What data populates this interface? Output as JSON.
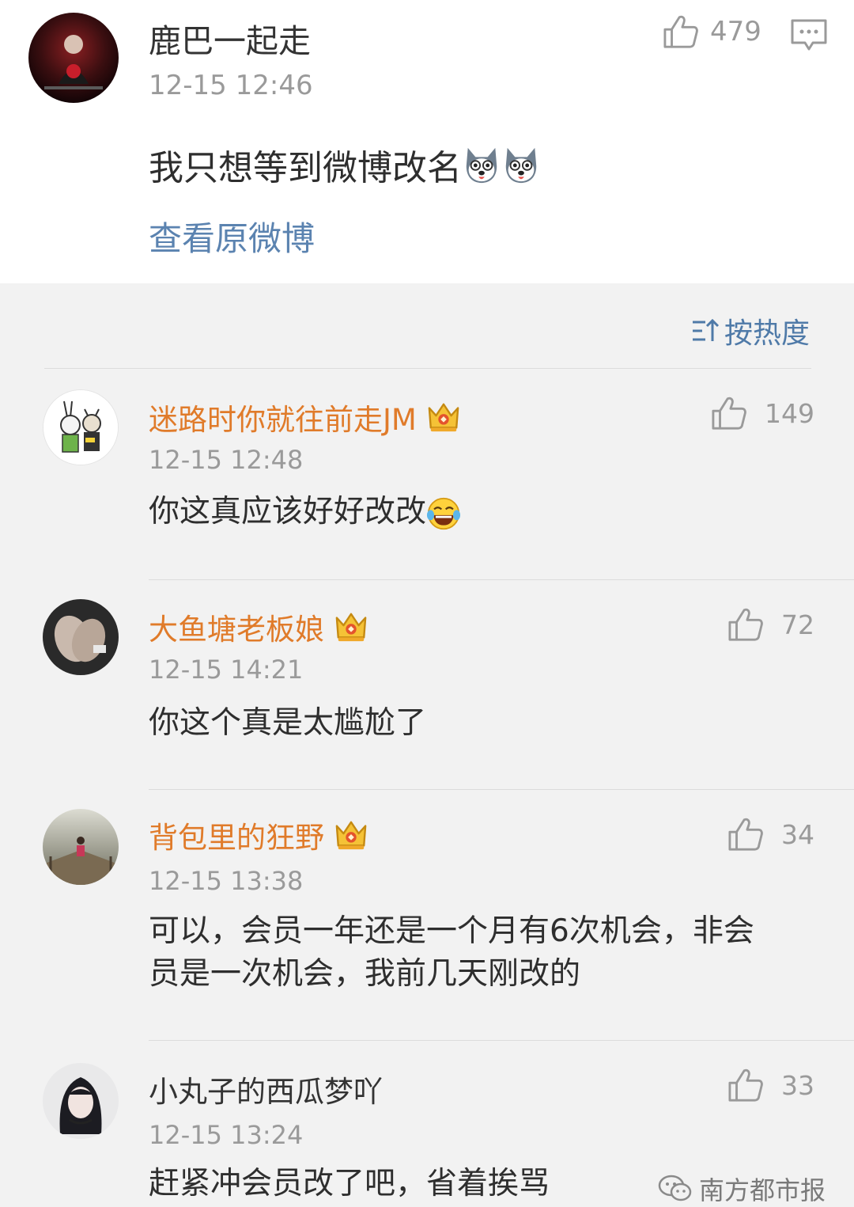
{
  "post": {
    "username": "鹿巴一起走",
    "time": "12-15 12:46",
    "text": "我只想等到微博改名",
    "emojis": [
      "husky-emoji",
      "husky-emoji"
    ],
    "view_original_link": "查看原微博",
    "like_count": "479"
  },
  "sort": {
    "label": "按热度",
    "icon": "sort-icon"
  },
  "comments": [
    {
      "username": "迷路时你就往前走JM",
      "vip": true,
      "time": "12-15 12:48",
      "text": "你这真应该好好改改",
      "emoji": "laugh-cry-emoji",
      "like_count": "149"
    },
    {
      "username": "大鱼塘老板娘",
      "vip": true,
      "time": "12-15 14:21",
      "text": "你这个真是太尴尬了",
      "like_count": "72"
    },
    {
      "username": "背包里的狂野",
      "vip": true,
      "time": "12-15 13:38",
      "text_line1": "可以，会员一年还是一个月有6次机会，非会",
      "text_line2": "员是一次机会，我前几天刚改的",
      "like_count": "34"
    },
    {
      "username": "小丸子的西瓜梦吖",
      "vip": false,
      "time": "12-15 13:24",
      "text": "赶紧冲会员改了吧，省着挨骂",
      "like_count": "33"
    }
  ],
  "watermark": {
    "label": "南方都市报",
    "icon": "wechat-icon"
  },
  "colors": {
    "vip_name": "#e07b2a",
    "link": "#5b83b0",
    "meta": "#9a9a9a",
    "background": "#f2f2f2"
  }
}
